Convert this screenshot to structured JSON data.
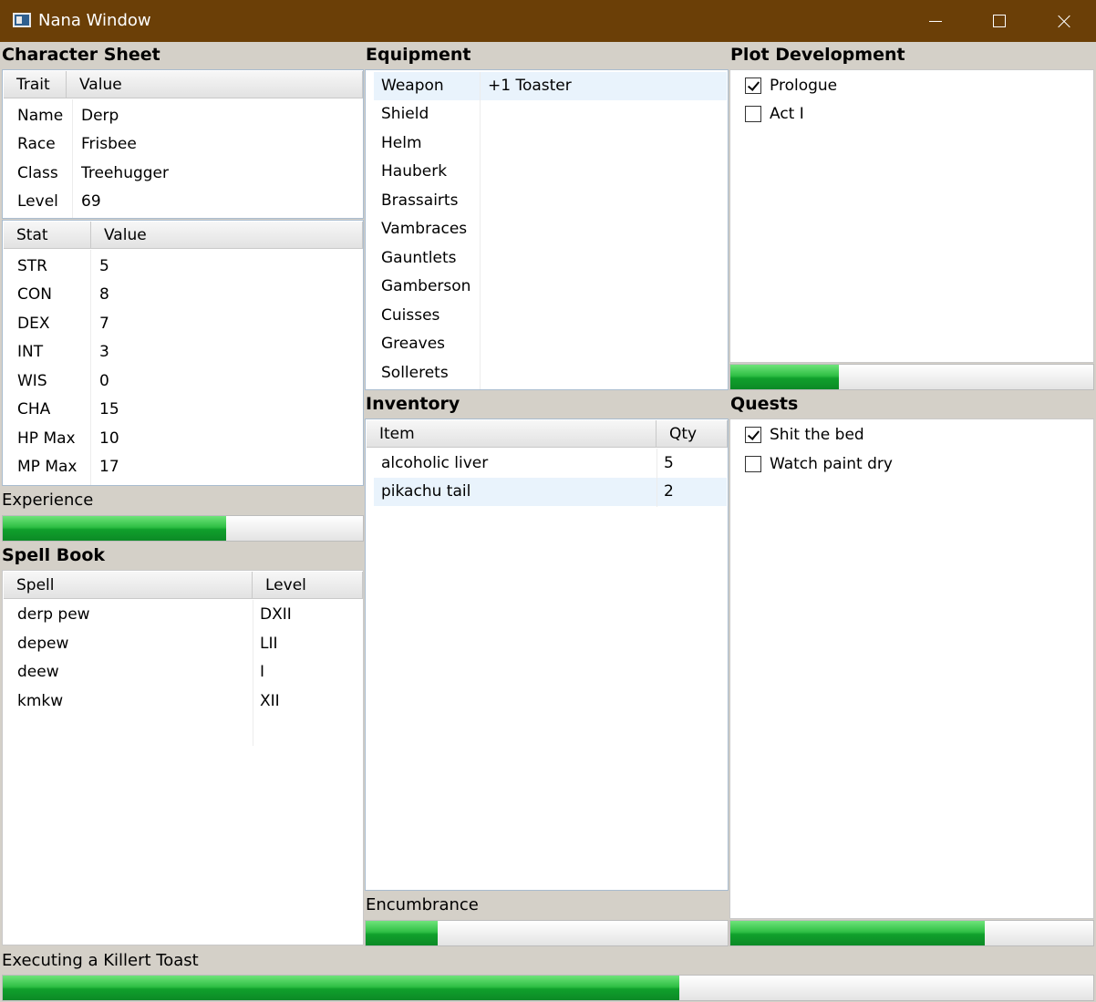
{
  "window": {
    "title": "Nana Window"
  },
  "character_sheet": {
    "header": "Character Sheet",
    "traits": {
      "columns": [
        "Trait",
        "Value"
      ],
      "rows": [
        [
          "Name",
          "Derp"
        ],
        [
          "Race",
          "Frisbee"
        ],
        [
          "Class",
          "Treehugger"
        ],
        [
          "Level",
          "69"
        ]
      ]
    },
    "stats": {
      "columns": [
        "Stat",
        "Value"
      ],
      "rows": [
        [
          "STR",
          "5"
        ],
        [
          "CON",
          "8"
        ],
        [
          "DEX",
          "7"
        ],
        [
          "INT",
          "3"
        ],
        [
          "WIS",
          "0"
        ],
        [
          "CHA",
          "15"
        ],
        [
          "HP Max",
          "10"
        ],
        [
          "MP Max",
          "17"
        ]
      ]
    }
  },
  "experience": {
    "label": "Experience",
    "progress": 0.62
  },
  "spell_book": {
    "header": "Spell Book",
    "columns": [
      "Spell",
      "Level"
    ],
    "rows": [
      [
        "derp pew",
        "DXII"
      ],
      [
        "depew",
        "LII"
      ],
      [
        "deew",
        "I"
      ],
      [
        "kmkw",
        "XII"
      ]
    ]
  },
  "equipment": {
    "header": "Equipment",
    "rows": [
      [
        "Weapon",
        "+1 Toaster"
      ],
      [
        "Shield",
        ""
      ],
      [
        "Helm",
        ""
      ],
      [
        "Hauberk",
        ""
      ],
      [
        "Brassairts",
        ""
      ],
      [
        "Vambraces",
        ""
      ],
      [
        "Gauntlets",
        ""
      ],
      [
        "Gamberson",
        ""
      ],
      [
        "Cuisses",
        ""
      ],
      [
        "Greaves",
        ""
      ],
      [
        "Sollerets",
        ""
      ]
    ]
  },
  "inventory": {
    "header": "Inventory",
    "columns": [
      "Item",
      "Qty"
    ],
    "rows": [
      [
        "alcoholic liver",
        "5"
      ],
      [
        "pikachu tail",
        "2"
      ]
    ]
  },
  "encumbrance": {
    "label": "Encumbrance",
    "progress": 0.2
  },
  "plot_development": {
    "header": "Plot Development",
    "items": [
      {
        "label": "Prologue",
        "checked": true
      },
      {
        "label": "Act I",
        "checked": false
      }
    ],
    "progress": 0.3
  },
  "quests": {
    "header": "Quests",
    "items": [
      {
        "label": "Shit the bed",
        "checked": true
      },
      {
        "label": "Watch paint dry",
        "checked": false
      }
    ],
    "progress": 0.7
  },
  "task": {
    "label": "Executing a Killert Toast",
    "progress": 0.62
  },
  "colors": {
    "titlebar": "#6b3f07",
    "panel_bg": "#d4d0c8",
    "progress_green": "#2fbf45",
    "selection": "#e9f3fc"
  }
}
